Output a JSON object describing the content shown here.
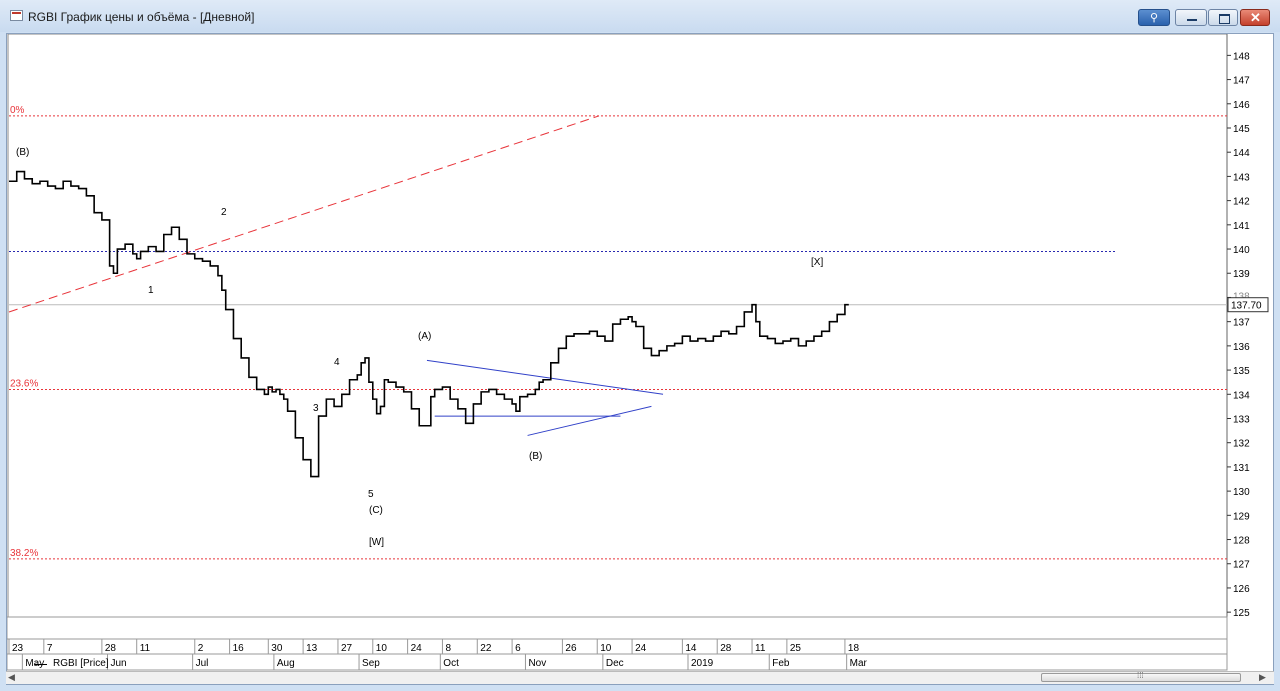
{
  "window": {
    "title": "RGBI График цены и объёма - [Дневной]",
    "buttons": {
      "pin": "⚲",
      "close": "✕"
    }
  },
  "legend": {
    "label": "RGBI [Price]"
  },
  "price_axis": {
    "ticks": [
      "148",
      "147",
      "146",
      "145",
      "144",
      "143",
      "142",
      "141",
      "140",
      "139",
      "138",
      "137",
      "136",
      "135",
      "134",
      "133",
      "132",
      "131",
      "130",
      "129",
      "128",
      "127",
      "126",
      "125"
    ],
    "current_price": "137.70"
  },
  "fib_levels": [
    {
      "label": "0%",
      "value": 145.5
    },
    {
      "label": "23.6%",
      "value": 134.2
    },
    {
      "label": "38.2%",
      "value": 127.2
    }
  ],
  "reference_levels": {
    "blue_dotted": 139.9,
    "gray_solid": 137.7
  },
  "wave_labels": [
    "(B)",
    "1",
    "2",
    "3",
    "4",
    "5",
    "(C)",
    "[W]",
    "(A)",
    "(B)",
    "[X]"
  ],
  "date_axis": {
    "days": [
      {
        "label": "23",
        "x": 0
      },
      {
        "label": "7",
        "x": 9
      },
      {
        "label": "28",
        "x": 24
      },
      {
        "label": "11",
        "x": 33
      },
      {
        "label": "2",
        "x": 48
      },
      {
        "label": "16",
        "x": 57
      },
      {
        "label": "30",
        "x": 67
      },
      {
        "label": "13",
        "x": 76
      },
      {
        "label": "27",
        "x": 85
      },
      {
        "label": "10",
        "x": 94
      },
      {
        "label": "24",
        "x": 103
      },
      {
        "label": "8",
        "x": 112
      },
      {
        "label": "22",
        "x": 121
      },
      {
        "label": "6",
        "x": 130
      },
      {
        "label": "26",
        "x": 143
      },
      {
        "label": "10",
        "x": 152
      },
      {
        "label": "24",
        "x": 161
      },
      {
        "label": "14",
        "x": 174
      },
      {
        "label": "28",
        "x": 183
      },
      {
        "label": "11",
        "x": 192
      },
      {
        "label": "25",
        "x": 201
      },
      {
        "label": "18",
        "x": 216
      }
    ],
    "months": [
      {
        "label": "May",
        "x": 5
      },
      {
        "label": "Jun",
        "x": 27
      },
      {
        "label": "Jul",
        "x": 49
      },
      {
        "label": "Aug",
        "x": 70
      },
      {
        "label": "Sep",
        "x": 92
      },
      {
        "label": "Oct",
        "x": 113
      },
      {
        "label": "Nov",
        "x": 135
      },
      {
        "label": "Dec",
        "x": 155
      },
      {
        "label": "2019",
        "x": 177
      },
      {
        "label": "Feb",
        "x": 198
      },
      {
        "label": "Mar",
        "x": 218
      }
    ]
  },
  "colors": {
    "price": "#000000",
    "fib": "#e8343a",
    "trend": "#3040c8",
    "accent_red_dash": "#e8343a"
  },
  "chart_data": {
    "type": "line",
    "title": "",
    "xlabel": "",
    "ylabel": "",
    "ylim": [
      124.8,
      148.8
    ],
    "x": [
      0,
      2,
      4,
      6,
      8,
      10,
      12,
      14,
      16,
      18,
      20,
      22,
      24,
      26,
      27,
      28,
      30,
      32,
      33,
      34,
      36,
      38,
      40,
      42,
      44,
      46,
      48,
      50,
      52,
      54,
      55,
      56,
      58,
      60,
      62,
      64,
      66,
      67,
      68,
      69,
      70,
      71,
      72,
      74,
      76,
      78,
      80,
      82,
      84,
      86,
      88,
      90,
      91,
      92,
      93,
      94,
      95,
      96,
      97,
      98,
      100,
      102,
      104,
      106,
      108,
      109,
      110,
      112,
      114,
      116,
      118,
      120,
      122,
      124,
      126,
      128,
      130,
      131,
      132,
      134,
      136,
      137,
      138,
      140,
      142,
      144,
      146,
      148,
      150,
      152,
      154,
      156,
      158,
      160,
      161,
      162,
      164,
      166,
      168,
      170,
      172,
      174,
      176,
      178,
      180,
      182,
      184,
      186,
      188,
      190,
      192,
      193,
      194,
      196,
      198,
      200,
      202,
      204,
      206,
      208,
      210,
      212,
      214,
      216,
      217,
      218
    ],
    "y": [
      142.8,
      143.2,
      142.9,
      142.7,
      142.8,
      142.6,
      142.5,
      142.8,
      142.6,
      142.5,
      142.2,
      141.5,
      141.2,
      139.3,
      139.0,
      140.0,
      140.2,
      139.8,
      139.6,
      139.9,
      140.1,
      139.9,
      140.6,
      140.9,
      140.4,
      139.8,
      139.6,
      139.5,
      139.3,
      138.9,
      138.3,
      137.5,
      136.3,
      135.5,
      134.7,
      134.2,
      134.0,
      134.3,
      134.1,
      134.2,
      134.0,
      133.8,
      133.3,
      132.2,
      131.3,
      130.6,
      133.1,
      133.8,
      133.5,
      134.0,
      134.6,
      134.8,
      135.3,
      135.5,
      134.5,
      133.8,
      133.2,
      133.5,
      134.6,
      134.5,
      134.3,
      134.1,
      133.4,
      132.7,
      132.7,
      133.9,
      134.2,
      134.3,
      133.8,
      133.4,
      132.8,
      133.6,
      134.1,
      134.2,
      134.0,
      133.8,
      133.6,
      133.3,
      133.9,
      134.0,
      134.2,
      134.5,
      134.6,
      135.3,
      135.9,
      136.4,
      136.5,
      136.5,
      136.6,
      136.4,
      136.2,
      136.9,
      137.1,
      137.2,
      137.0,
      136.8,
      135.9,
      135.6,
      135.8,
      136.0,
      136.1,
      136.4,
      136.2,
      136.3,
      136.2,
      136.4,
      136.6,
      136.5,
      136.8,
      137.4,
      137.7,
      137.0,
      136.4,
      136.3,
      136.1,
      136.2,
      136.3,
      136.0,
      136.2,
      136.4,
      136.6,
      137.0,
      137.3,
      137.7
    ]
  }
}
